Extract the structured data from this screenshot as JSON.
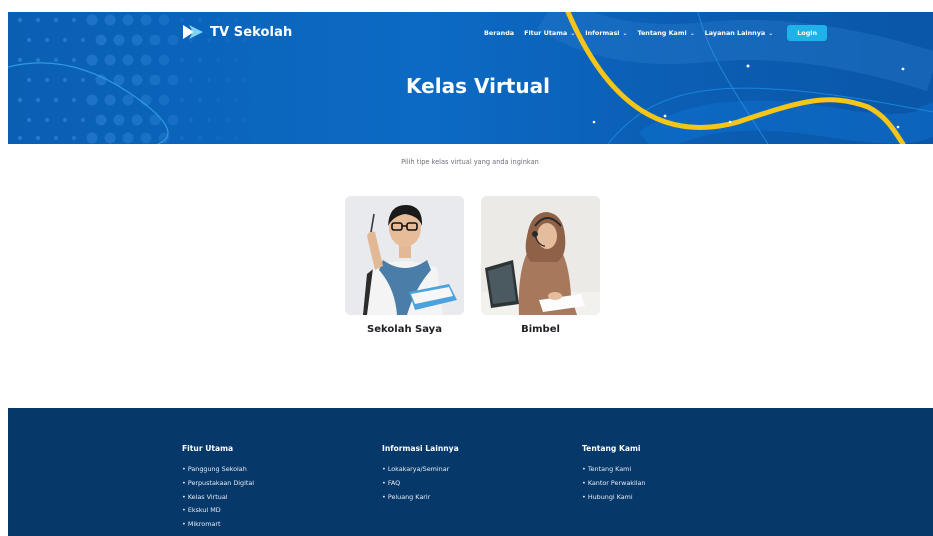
{
  "brand": {
    "name": "TV Sekolah"
  },
  "nav": {
    "items": [
      {
        "label": "Beranda",
        "dropdown": false
      },
      {
        "label": "Fitur Utama",
        "dropdown": true
      },
      {
        "label": "Informasi",
        "dropdown": true
      },
      {
        "label": "Tentang Kami",
        "dropdown": true
      },
      {
        "label": "Layanan Lainnya",
        "dropdown": true
      }
    ],
    "login_label": "Login"
  },
  "hero": {
    "title": "Kelas Virtual"
  },
  "main": {
    "subtitle": "Pilih tipe kelas virtual yang anda inginkan",
    "options": [
      {
        "label": "Sekolah Saya"
      },
      {
        "label": "Bimbel"
      }
    ]
  },
  "footer": {
    "columns": [
      {
        "title": "Fitur Utama",
        "links": [
          "Panggung Sekolah",
          "Perpustakaan Digital",
          "Kelas Virtual",
          "Ekskul MD",
          "Mikromart"
        ]
      },
      {
        "title": "Informasi Lainnya",
        "links": [
          "Lokakarya/Seminar",
          "FAQ",
          "Peluang Karir"
        ]
      },
      {
        "title": "Tentang Kami",
        "links": [
          "Tentang Kami",
          "Kantor Perwakilan",
          "Hubungi Kami"
        ]
      }
    ]
  },
  "colors": {
    "hero_blue": "#0c6ac4",
    "accent_yellow": "#f5c518",
    "login_cyan": "#1fb2e8",
    "footer_navy": "#06386a"
  }
}
